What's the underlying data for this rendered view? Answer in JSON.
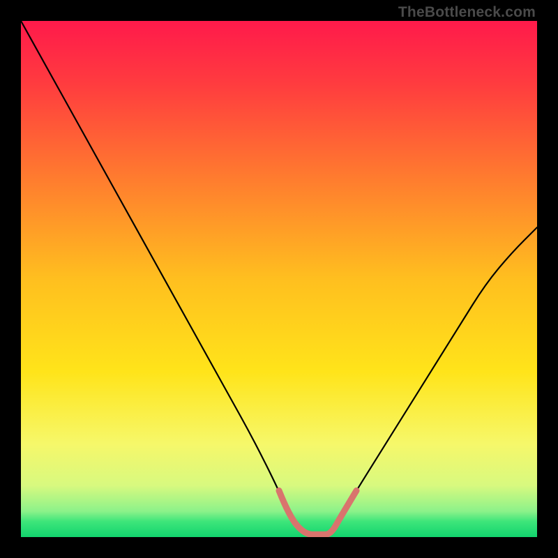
{
  "watermark": "TheBottleneck.com",
  "chart_data": {
    "type": "line",
    "title": "",
    "xlabel": "",
    "ylabel": "",
    "xlim": [
      0,
      100
    ],
    "ylim": [
      0,
      100
    ],
    "grid": false,
    "series": [
      {
        "name": "bottleneck-curve",
        "x": [
          0,
          5,
          10,
          15,
          20,
          25,
          30,
          35,
          40,
          45,
          50,
          52,
          55,
          58,
          60,
          62,
          65,
          70,
          75,
          80,
          85,
          90,
          95,
          100
        ],
        "y": [
          100,
          91,
          82,
          73,
          64,
          55,
          46,
          37,
          28,
          19,
          9,
          4,
          0.5,
          0.5,
          0.5,
          4,
          9,
          17,
          25,
          33,
          41,
          49,
          55,
          60
        ]
      },
      {
        "name": "optimal-zone",
        "x": [
          50,
          52,
          55,
          58,
          60,
          62,
          65
        ],
        "y": [
          9,
          4,
          0.5,
          0.5,
          0.5,
          4,
          9
        ]
      }
    ],
    "gradient_stops": [
      {
        "offset": 0.0,
        "color": "#ff1a4b"
      },
      {
        "offset": 0.12,
        "color": "#ff3b3f"
      },
      {
        "offset": 0.3,
        "color": "#ff7a2f"
      },
      {
        "offset": 0.5,
        "color": "#ffbf1f"
      },
      {
        "offset": 0.68,
        "color": "#ffe41a"
      },
      {
        "offset": 0.82,
        "color": "#f6f86a"
      },
      {
        "offset": 0.9,
        "color": "#d8f97f"
      },
      {
        "offset": 0.95,
        "color": "#8cf28a"
      },
      {
        "offset": 0.97,
        "color": "#3de57a"
      },
      {
        "offset": 1.0,
        "color": "#12d46e"
      }
    ],
    "valley_stroke": "#d9746d"
  }
}
